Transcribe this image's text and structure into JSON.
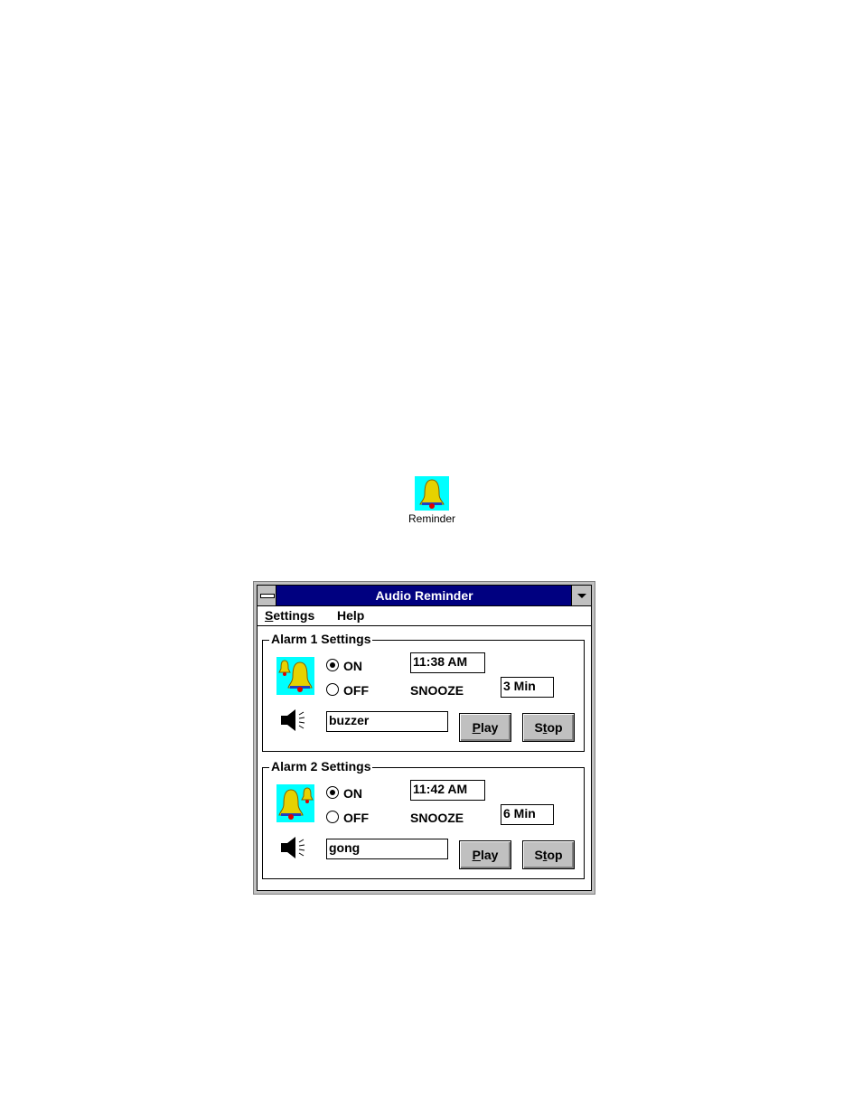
{
  "desktop_icon": {
    "label": "Reminder",
    "icon": "bell-icon"
  },
  "window": {
    "title": "Audio Reminder",
    "menu": [
      {
        "label": "Settings",
        "accel": "S"
      },
      {
        "label": "Help"
      }
    ]
  },
  "alarms": [
    {
      "legend": "Alarm 1 Settings",
      "on_label": "ON",
      "off_label": "OFF",
      "selected": "ON",
      "time": "11:38 AM",
      "snooze_label": "SNOOZE",
      "snooze": "3 Min",
      "sound": "buzzer",
      "play_label": "Play",
      "stop_label": "Stop"
    },
    {
      "legend": "Alarm 2 Settings",
      "on_label": "ON",
      "off_label": "OFF",
      "selected": "ON",
      "time": "11:42 AM",
      "snooze_label": "SNOOZE",
      "snooze": "6 Min",
      "sound": "gong",
      "play_label": "Play",
      "stop_label": "Stop"
    }
  ]
}
